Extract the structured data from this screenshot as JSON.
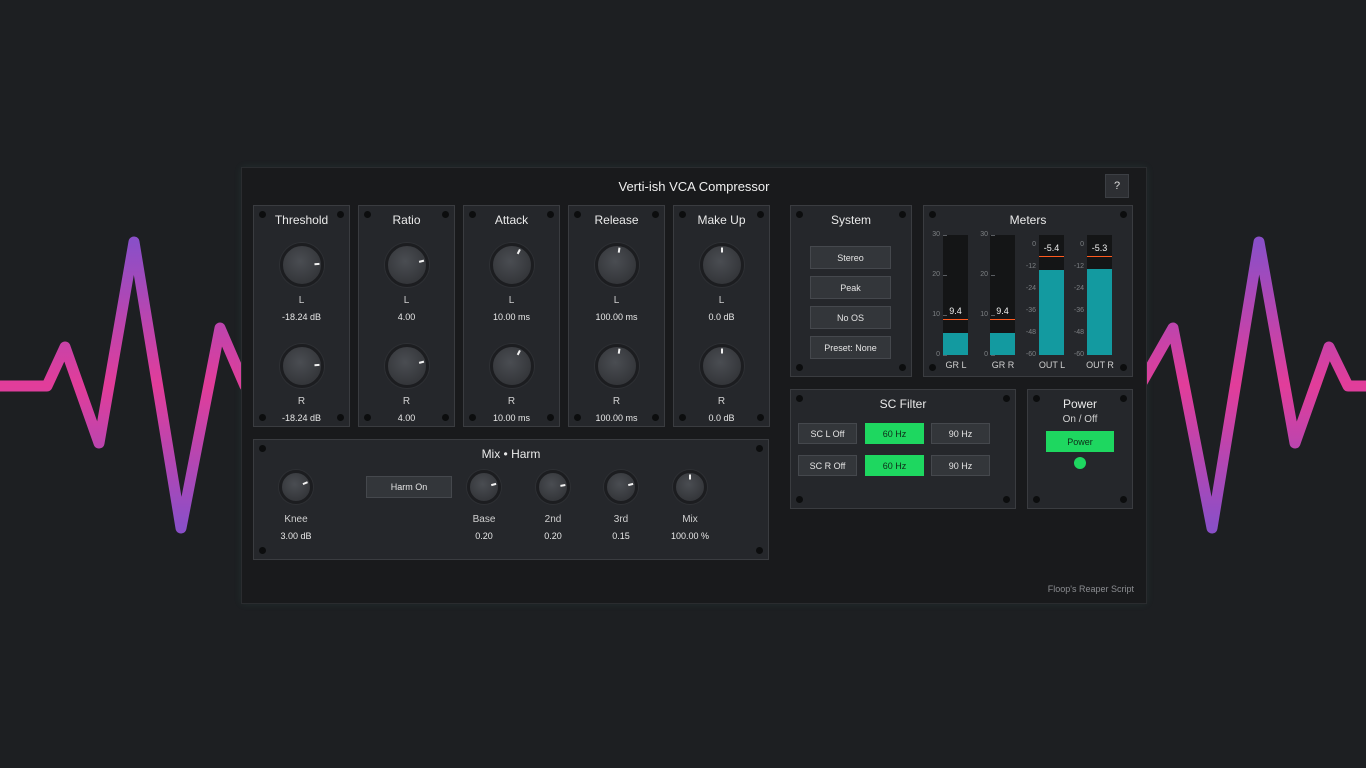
{
  "window": {
    "title": "Verti-ish VCA Compressor",
    "help_label": "?",
    "footer": "Floop's Reaper Script"
  },
  "knob_panels": [
    {
      "title": "Threshold",
      "left_label": "L",
      "left_value": "-18.24 dB",
      "right_label": "R",
      "right_value": "-18.24 dB",
      "level": 0.82
    },
    {
      "title": "Ratio",
      "left_label": "L",
      "left_value": "4.00",
      "right_label": "R",
      "right_value": "4.00",
      "level": 0.78
    },
    {
      "title": "Attack",
      "left_label": "L",
      "left_value": "10.00 ms",
      "right_label": "R",
      "right_value": "10.00 ms",
      "level": 0.6
    },
    {
      "title": "Release",
      "left_label": "L",
      "left_value": "100.00 ms",
      "right_label": "R",
      "right_value": "100.00 ms",
      "level": 0.53
    },
    {
      "title": "Make Up",
      "left_label": "L",
      "left_value": "0.0 dB",
      "right_label": "R",
      "right_value": "0.0 dB",
      "level": 0.5
    }
  ],
  "mix_harm": {
    "title": "Mix • Harm",
    "harm_button": "Harm On",
    "knobs": [
      {
        "label": "Knee",
        "value": "3.00 dB",
        "level": 0.75
      },
      {
        "label": "Base",
        "value": "0.20",
        "level": 0.78
      },
      {
        "label": "2nd",
        "value": "0.20",
        "level": 0.8
      },
      {
        "label": "3rd",
        "value": "0.15",
        "level": 0.78
      },
      {
        "label": "Mix",
        "value": "100.00 %",
        "level": 0.5
      }
    ]
  },
  "system": {
    "title": "System",
    "buttons": [
      "Stereo",
      "Peak",
      "No OS",
      "Preset: None"
    ]
  },
  "meters": {
    "title": "Meters",
    "gr_scale": [
      "30",
      "20",
      "10",
      "0"
    ],
    "out_scale": [
      "0",
      "-12",
      "-24",
      "-36",
      "-48",
      "-60"
    ],
    "channels": [
      {
        "label": "GR L",
        "readout": "9.4",
        "fill": 0.18
      },
      {
        "label": "GR R",
        "readout": "9.4",
        "fill": 0.18
      },
      {
        "label": "OUT L",
        "readout": "-5.4",
        "fill": 0.71
      },
      {
        "label": "OUT R",
        "readout": "-5.3",
        "fill": 0.72
      }
    ]
  },
  "sc_filter": {
    "title": "SC Filter",
    "rows": [
      {
        "toggle": "SC L Off",
        "opt1": "60 Hz",
        "opt2": "90 Hz"
      },
      {
        "toggle": "SC R Off",
        "opt1": "60 Hz",
        "opt2": "90 Hz"
      }
    ]
  },
  "power": {
    "title": "Power",
    "subtitle": "On / Off",
    "button": "Power"
  },
  "colors": {
    "accent_green": "#1ed760",
    "meter_teal": "#139aa0",
    "meter_peak": "#ff5a1f",
    "wave_pink": "#e23d9a",
    "wave_purple": "#8a4fc8"
  }
}
